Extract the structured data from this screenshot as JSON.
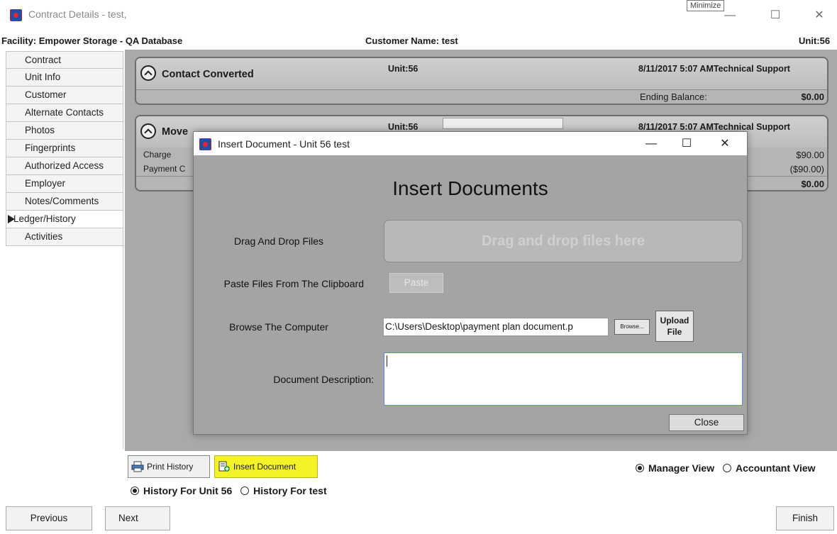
{
  "window": {
    "title": "Contract Details - test,",
    "tooltip": "Minimize",
    "minimize": "—",
    "maximize": "☐",
    "close": "✕"
  },
  "info": {
    "facility": "Facility: Empower Storage - QA Database",
    "customer": "Customer Name: test",
    "unit": "Unit:56"
  },
  "nav": {
    "items": [
      {
        "label": "Contract"
      },
      {
        "label": "Unit Info"
      },
      {
        "label": "Customer"
      },
      {
        "label": "Alternate Contacts"
      },
      {
        "label": "Photos"
      },
      {
        "label": "Fingerprints"
      },
      {
        "label": "Authorized Access"
      },
      {
        "label": "Employer"
      },
      {
        "label": "Notes/Comments"
      },
      {
        "label": "Ledger/History"
      },
      {
        "label": "Activities"
      }
    ],
    "active_index": 9
  },
  "cards": [
    {
      "title": "Contact Converted",
      "unit": "Unit:56",
      "date": "8/11/2017 5:07 AMTechnical Support",
      "foot_label": "Ending Balance:",
      "foot_value": "$0.00"
    },
    {
      "title": "Move",
      "unit": "Unit:56",
      "date": "8/11/2017 5:07 AMTechnical Support",
      "row1_label": "Charge",
      "row1_value": "$90.00",
      "row2_label": "Payment C",
      "row2_value": "($90.00)",
      "total": "$0.00"
    }
  ],
  "toolbar": {
    "print_history": "Print History",
    "insert_document": "Insert Document",
    "manager_view": "Manager View",
    "accountant_view": "Accountant View",
    "history_unit": "History For Unit 56",
    "history_customer": "History For  test"
  },
  "footer": {
    "previous": "Previous",
    "next": "Next",
    "finish": "Finish"
  },
  "modal": {
    "title": "Insert Document - Unit 56  test",
    "heading": "Insert Documents",
    "drag_label": "Drag And Drop Files",
    "dropzone_text": "Drag and drop files here",
    "paste_label": "Paste Files From The Clipboard",
    "paste_button": "Paste",
    "browse_label": "Browse The Computer",
    "file_path": "C:\\Users\\Desktop\\payment plan document.p",
    "browse_button": "Browse...",
    "upload_line1": "Upload",
    "upload_line2": "File",
    "description_label": "Document Description:",
    "description_value": "",
    "close_button": "Close"
  },
  "colors": {
    "highlight": "#f4f32a",
    "panel": "#a9a9a9",
    "modal": "#a4a4a4"
  }
}
